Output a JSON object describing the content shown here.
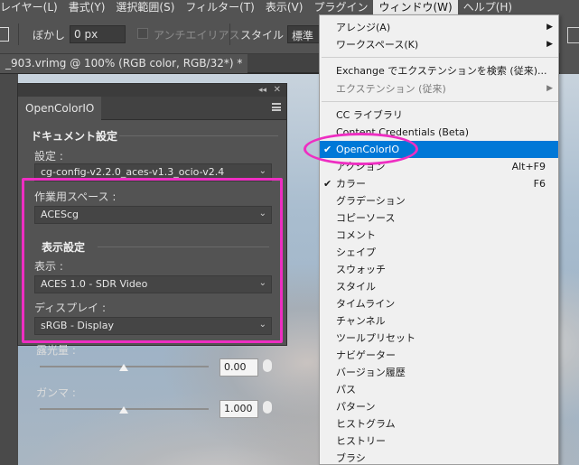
{
  "menubar": {
    "items": [
      "レイヤー(L)",
      "書式(Y)",
      "選択範囲(S)",
      "フィルター(T)",
      "表示(V)",
      "プラグイン",
      "ウィンドウ(W)",
      "ヘルプ(H)"
    ]
  },
  "options": {
    "blur_label": "ぼかし :",
    "blur_value": "0 px",
    "antialias_label": "アンチエイリアス",
    "style_label": "スタイル :",
    "style_value": "標準"
  },
  "document": {
    "tab_title": "_903.vrimg @ 100% (RGB color, RGB/32*) *"
  },
  "panel": {
    "tab": "OpenColorIO",
    "doc_settings_title": "ドキュメント設定",
    "config_label": "設定 :",
    "config_value": "cg-config-v2.2.0_aces-v1.3_ocio-v2.4",
    "working_space_label": "作業用スペース :",
    "working_space_value": "ACEScg",
    "display_settings_title": "表示設定",
    "view_label": "表示 :",
    "view_value": "ACES 1.0 - SDR Video",
    "display_label": "ディスプレイ :",
    "display_value": "sRGB - Display",
    "exposure_label": "露光量 :",
    "exposure_value": "0.00",
    "gamma_label": "ガンマ :",
    "gamma_value": "1.000"
  },
  "window_menu": {
    "items": [
      {
        "label": "アレンジ(A)",
        "submenu": true
      },
      {
        "label": "ワークスペース(K)",
        "submenu": true
      },
      {
        "label": "Exchange でエクステンションを検索 (従来)..."
      },
      {
        "label": "エクステンション (従来)",
        "submenu": true,
        "disabled": true
      },
      {
        "label": "CC ライブラリ"
      },
      {
        "label": "Content Credentials (Beta)"
      },
      {
        "label": "OpenColorIO",
        "checked": true,
        "selected": true
      },
      {
        "label": "アクション",
        "shortcut": "Alt+F9"
      },
      {
        "label": "カラー",
        "checked": true,
        "shortcut": "F6"
      },
      {
        "label": "グラデーション"
      },
      {
        "label": "コピーソース"
      },
      {
        "label": "コメント"
      },
      {
        "label": "シェイプ"
      },
      {
        "label": "スウォッチ"
      },
      {
        "label": "スタイル"
      },
      {
        "label": "タイムライン"
      },
      {
        "label": "チャンネル"
      },
      {
        "label": "ツールプリセット"
      },
      {
        "label": "ナビゲーター"
      },
      {
        "label": "バージョン履歴"
      },
      {
        "label": "パス"
      },
      {
        "label": "パターン"
      },
      {
        "label": "ヒストグラム"
      },
      {
        "label": "ヒストリー"
      },
      {
        "label": "ブラシ"
      }
    ]
  },
  "colors": {
    "highlight": "#ee2ec2",
    "menu_selection": "#0078d7",
    "ui_panel": "#535353"
  }
}
